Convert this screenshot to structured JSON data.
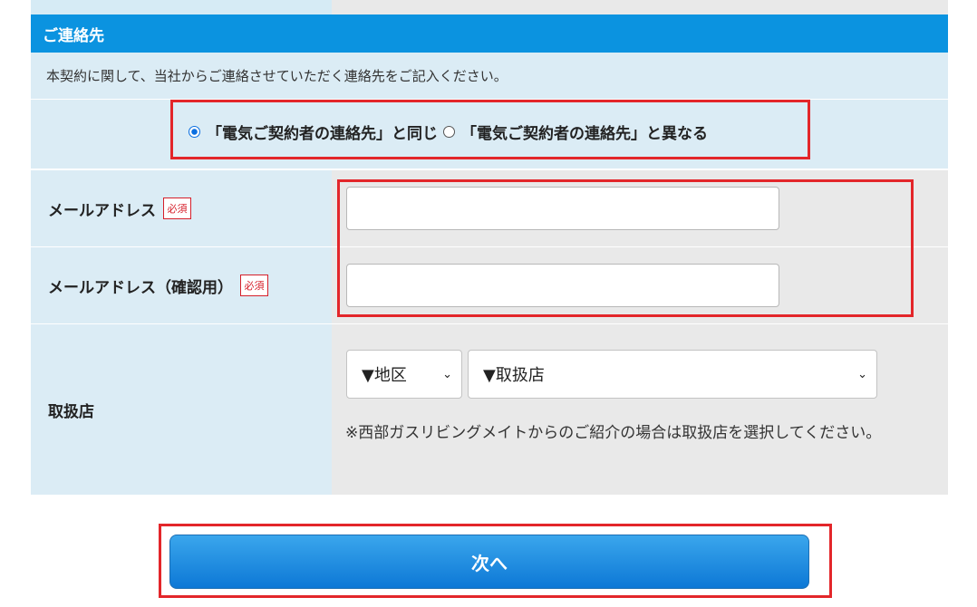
{
  "contact": {
    "header": "ご連絡先",
    "description": "本契約に関して、当社からご連絡させていただく連絡先をご記入ください。",
    "radio_options": [
      {
        "label": "「電気ご契約者の連絡先」と同じ",
        "selected": true
      },
      {
        "label": "「電気ご契約者の連絡先」と異なる",
        "selected": false
      }
    ],
    "required_badge": "必須",
    "email_label": "メールアドレス",
    "email_value": "",
    "email_confirm_label": "メールアドレス（確認用）",
    "email_confirm_value": "",
    "store_label": "取扱店",
    "region_select": "▼地区",
    "store_select": "▼取扱店",
    "store_note": "※西部ガスリビングメイトからのご紹介の場合は取扱店を選択してください。"
  },
  "next_button": "次へ",
  "colors": {
    "header_blue": "#0b93e0",
    "label_bg": "#dbecf5",
    "field_bg": "#e9e9e9",
    "required_red": "#d51f2a",
    "highlight_red": "#e3262a"
  }
}
